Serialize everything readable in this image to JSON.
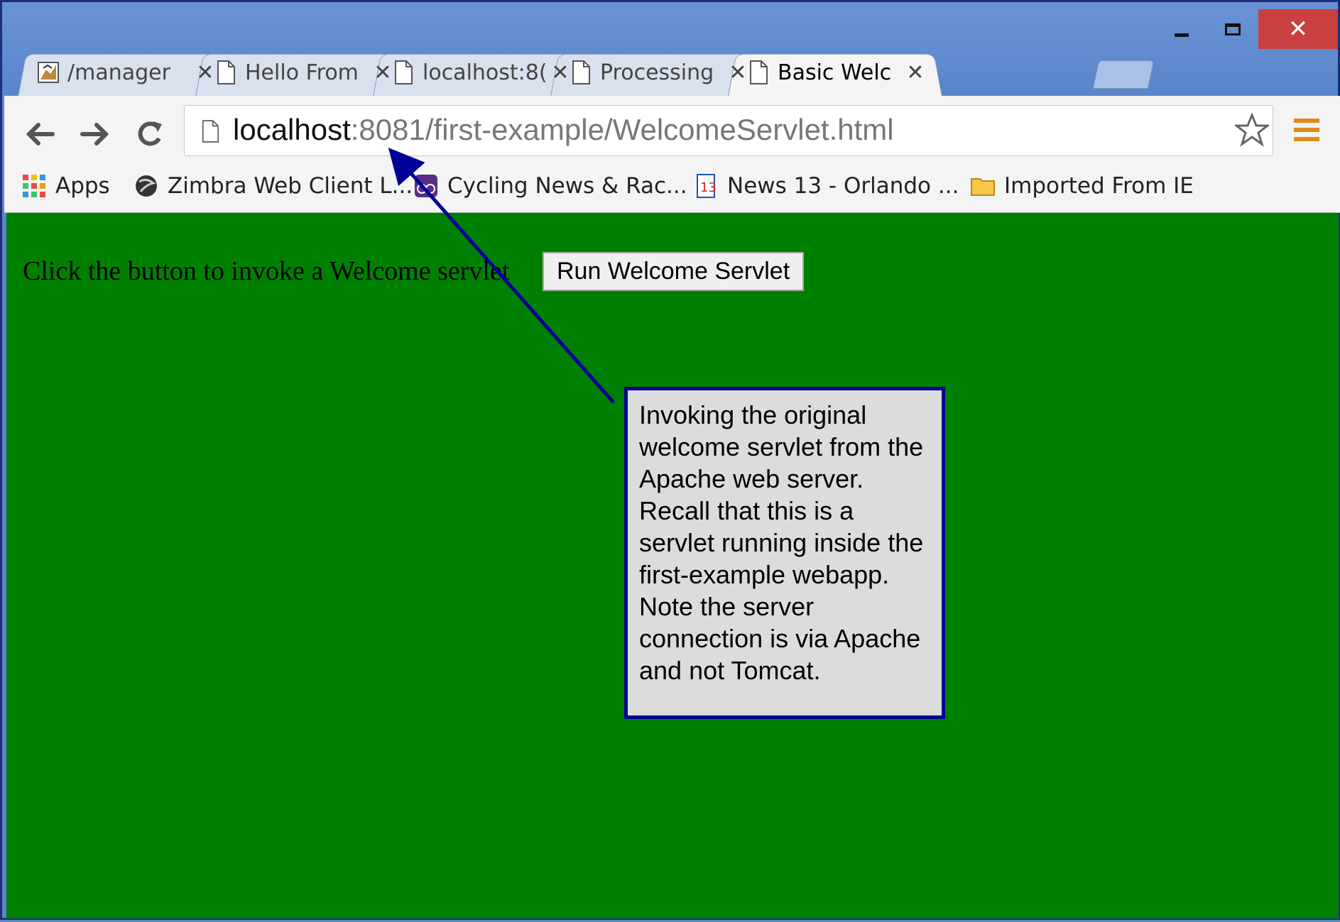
{
  "window": {
    "controls": {
      "minimize_icon": "minimize-icon",
      "maximize_icon": "maximize-icon",
      "close_glyph": "✕"
    }
  },
  "tabs": [
    {
      "title": "/manager",
      "icon": "tomcat-favicon",
      "active": false
    },
    {
      "title": "Hello From",
      "icon": "page-icon",
      "active": false
    },
    {
      "title": "localhost:8(",
      "icon": "page-icon",
      "active": false
    },
    {
      "title": "Processing",
      "icon": "page-icon",
      "active": false
    },
    {
      "title": "Basic Welc",
      "icon": "page-icon",
      "active": true
    }
  ],
  "tab_close_glyph": "✕",
  "toolbar": {
    "url_host": "localhost",
    "url_path": ":8081/first-example/WelcomeServlet.html"
  },
  "bookmarks": [
    {
      "label": "Apps",
      "icon": "apps-grid-icon"
    },
    {
      "label": "Zimbra Web Client L...",
      "icon": "zimbra-icon"
    },
    {
      "label": "Cycling News & Rac...",
      "icon": "cycling-icon"
    },
    {
      "label": "News 13 - Orlando ...",
      "icon": "news-icon"
    },
    {
      "label": "Imported From IE",
      "icon": "folder-icon"
    }
  ],
  "page": {
    "background": "#008000",
    "prompt": "Click the button to invoke a Welcome servlet",
    "button_label": "Run Welcome Servlet"
  },
  "callout": {
    "text": "Invoking the original welcome servlet from the Apache web server.  Recall that this is a servlet running inside the first-example webapp.  Note the server connection is via Apache and not Tomcat.",
    "border_color": "#000096",
    "arrow_color": "#000096"
  }
}
